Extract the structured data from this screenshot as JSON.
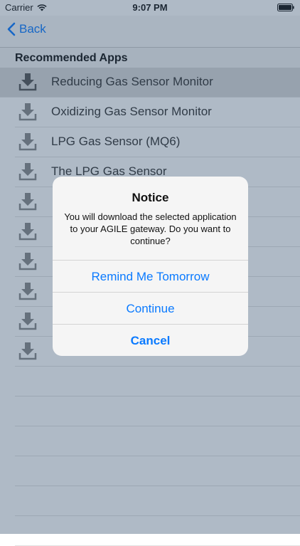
{
  "status_bar": {
    "carrier": "Carrier",
    "time": "9:07 PM"
  },
  "nav": {
    "back_label": "Back"
  },
  "section": {
    "title": "Recommended Apps"
  },
  "apps": [
    {
      "label": "Reducing Gas Sensor Monitor"
    },
    {
      "label": "Oxidizing Gas Sensor Monitor"
    },
    {
      "label": "LPG Gas Sensor (MQ6)"
    },
    {
      "label": "The LPG Gas Sensor"
    },
    {
      "label": ""
    },
    {
      "label": ""
    },
    {
      "label": ""
    },
    {
      "label": ""
    },
    {
      "label": ""
    },
    {
      "label": ""
    }
  ],
  "alert": {
    "title": "Notice",
    "message": "You will download the selected application to your AGILE gateway. Do you want to continue?",
    "buttons": {
      "remind": "Remind Me Tomorrow",
      "continue": "Continue",
      "cancel": "Cancel"
    }
  },
  "colors": {
    "accent": "#0a7aff",
    "selected_row": "#d9d9d9"
  },
  "icons": {
    "download": "download-icon",
    "back": "chevron-left-icon",
    "wifi": "wifi-icon",
    "battery": "battery-icon"
  }
}
